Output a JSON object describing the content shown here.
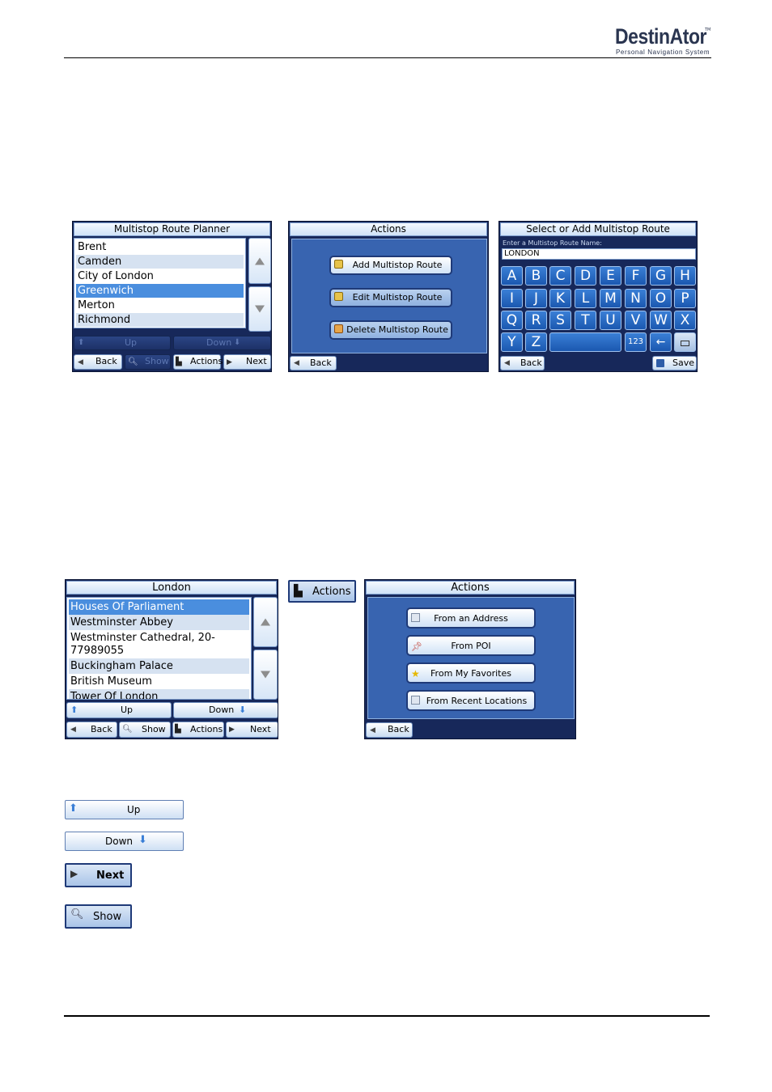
{
  "header": {
    "brand": "DestinAtor",
    "tagline": "Personal Navigation System",
    "tm": "TM"
  },
  "screen_planner": {
    "title": "Multistop Route Planner",
    "items": [
      "Brent",
      "Camden",
      "City of London",
      "Greenwich",
      "Merton",
      "Richmond"
    ],
    "selected": "Greenwich",
    "up": "Up",
    "down": "Down",
    "back": "Back",
    "show": "Show",
    "actions": "Actions",
    "next": "Next"
  },
  "screen_actions": {
    "title": "Actions",
    "add": "Add Multistop Route",
    "edit": "Edit Multistop Route",
    "delete": "Delete Multistop Route",
    "back": "Back"
  },
  "screen_keyboard": {
    "title": "Select or Add Multistop Route",
    "prompt": "Enter a Multistop Route Name:",
    "value": "LONDON",
    "keys_row1": [
      "A",
      "B",
      "C",
      "D",
      "E",
      "F",
      "G",
      "H"
    ],
    "keys_row2": [
      "I",
      "J",
      "K",
      "L",
      "M",
      "N",
      "O",
      "P"
    ],
    "keys_row3": [
      "Q",
      "R",
      "S",
      "T",
      "U",
      "V",
      "W",
      "X"
    ],
    "keys_row4": [
      "Y",
      "Z"
    ],
    "num_key": "123",
    "backspace_key": "←",
    "back": "Back",
    "save": "Save"
  },
  "screen_london": {
    "title": "London",
    "items": [
      "Houses Of Parliament",
      "Westminster Abbey",
      "Westminster Cathedral, 20-",
      "77989055",
      "Buckingham Palace",
      "British Museum",
      "Tower Of London"
    ],
    "selected": "Houses Of Parliament",
    "up": "Up",
    "down": "Down",
    "back": "Back",
    "show": "Show",
    "actions": "Actions",
    "next": "Next"
  },
  "actions_button": {
    "label": "Actions"
  },
  "screen_actions2": {
    "title": "Actions",
    "from_address": "From an Address",
    "from_poi": "From POI",
    "from_favorites": "From My Favorites",
    "from_recent": "From Recent Locations",
    "back": "Back"
  },
  "legend": {
    "up": "Up",
    "down": "Down",
    "next": "Next",
    "show": "Show"
  },
  "colors": {
    "screen_bg": "#17285a",
    "panel": "#3864b0",
    "selection": "#4a8ede",
    "key": "#1b58b0"
  }
}
